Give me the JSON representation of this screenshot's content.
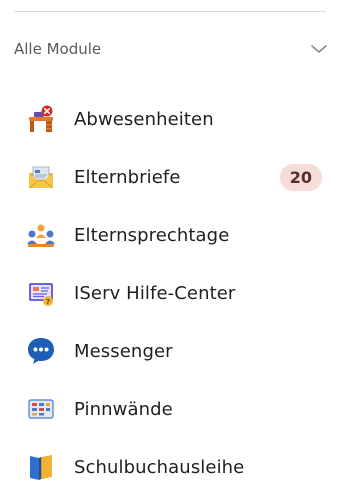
{
  "section": {
    "title": "Alle Module",
    "toggle_icon": "chevron-down-icon"
  },
  "modules": [
    {
      "label": "Abwesenheiten",
      "icon": "absence-desk-icon"
    },
    {
      "label": "Elternbriefe",
      "icon": "letter-envelope-icon",
      "badge": "20"
    },
    {
      "label": "Elternsprechtage",
      "icon": "meeting-people-icon"
    },
    {
      "label": "IServ Hilfe-Center",
      "icon": "help-center-icon"
    },
    {
      "label": "Messenger",
      "icon": "chat-bubble-icon"
    },
    {
      "label": "Pinnwände",
      "icon": "pinboard-icon"
    },
    {
      "label": "Schulbuchausleihe",
      "icon": "books-icon"
    }
  ],
  "colors": {
    "badge_bg": "#f7ddd9",
    "badge_text": "#5a2d29",
    "divider": "#d9d9d9"
  }
}
